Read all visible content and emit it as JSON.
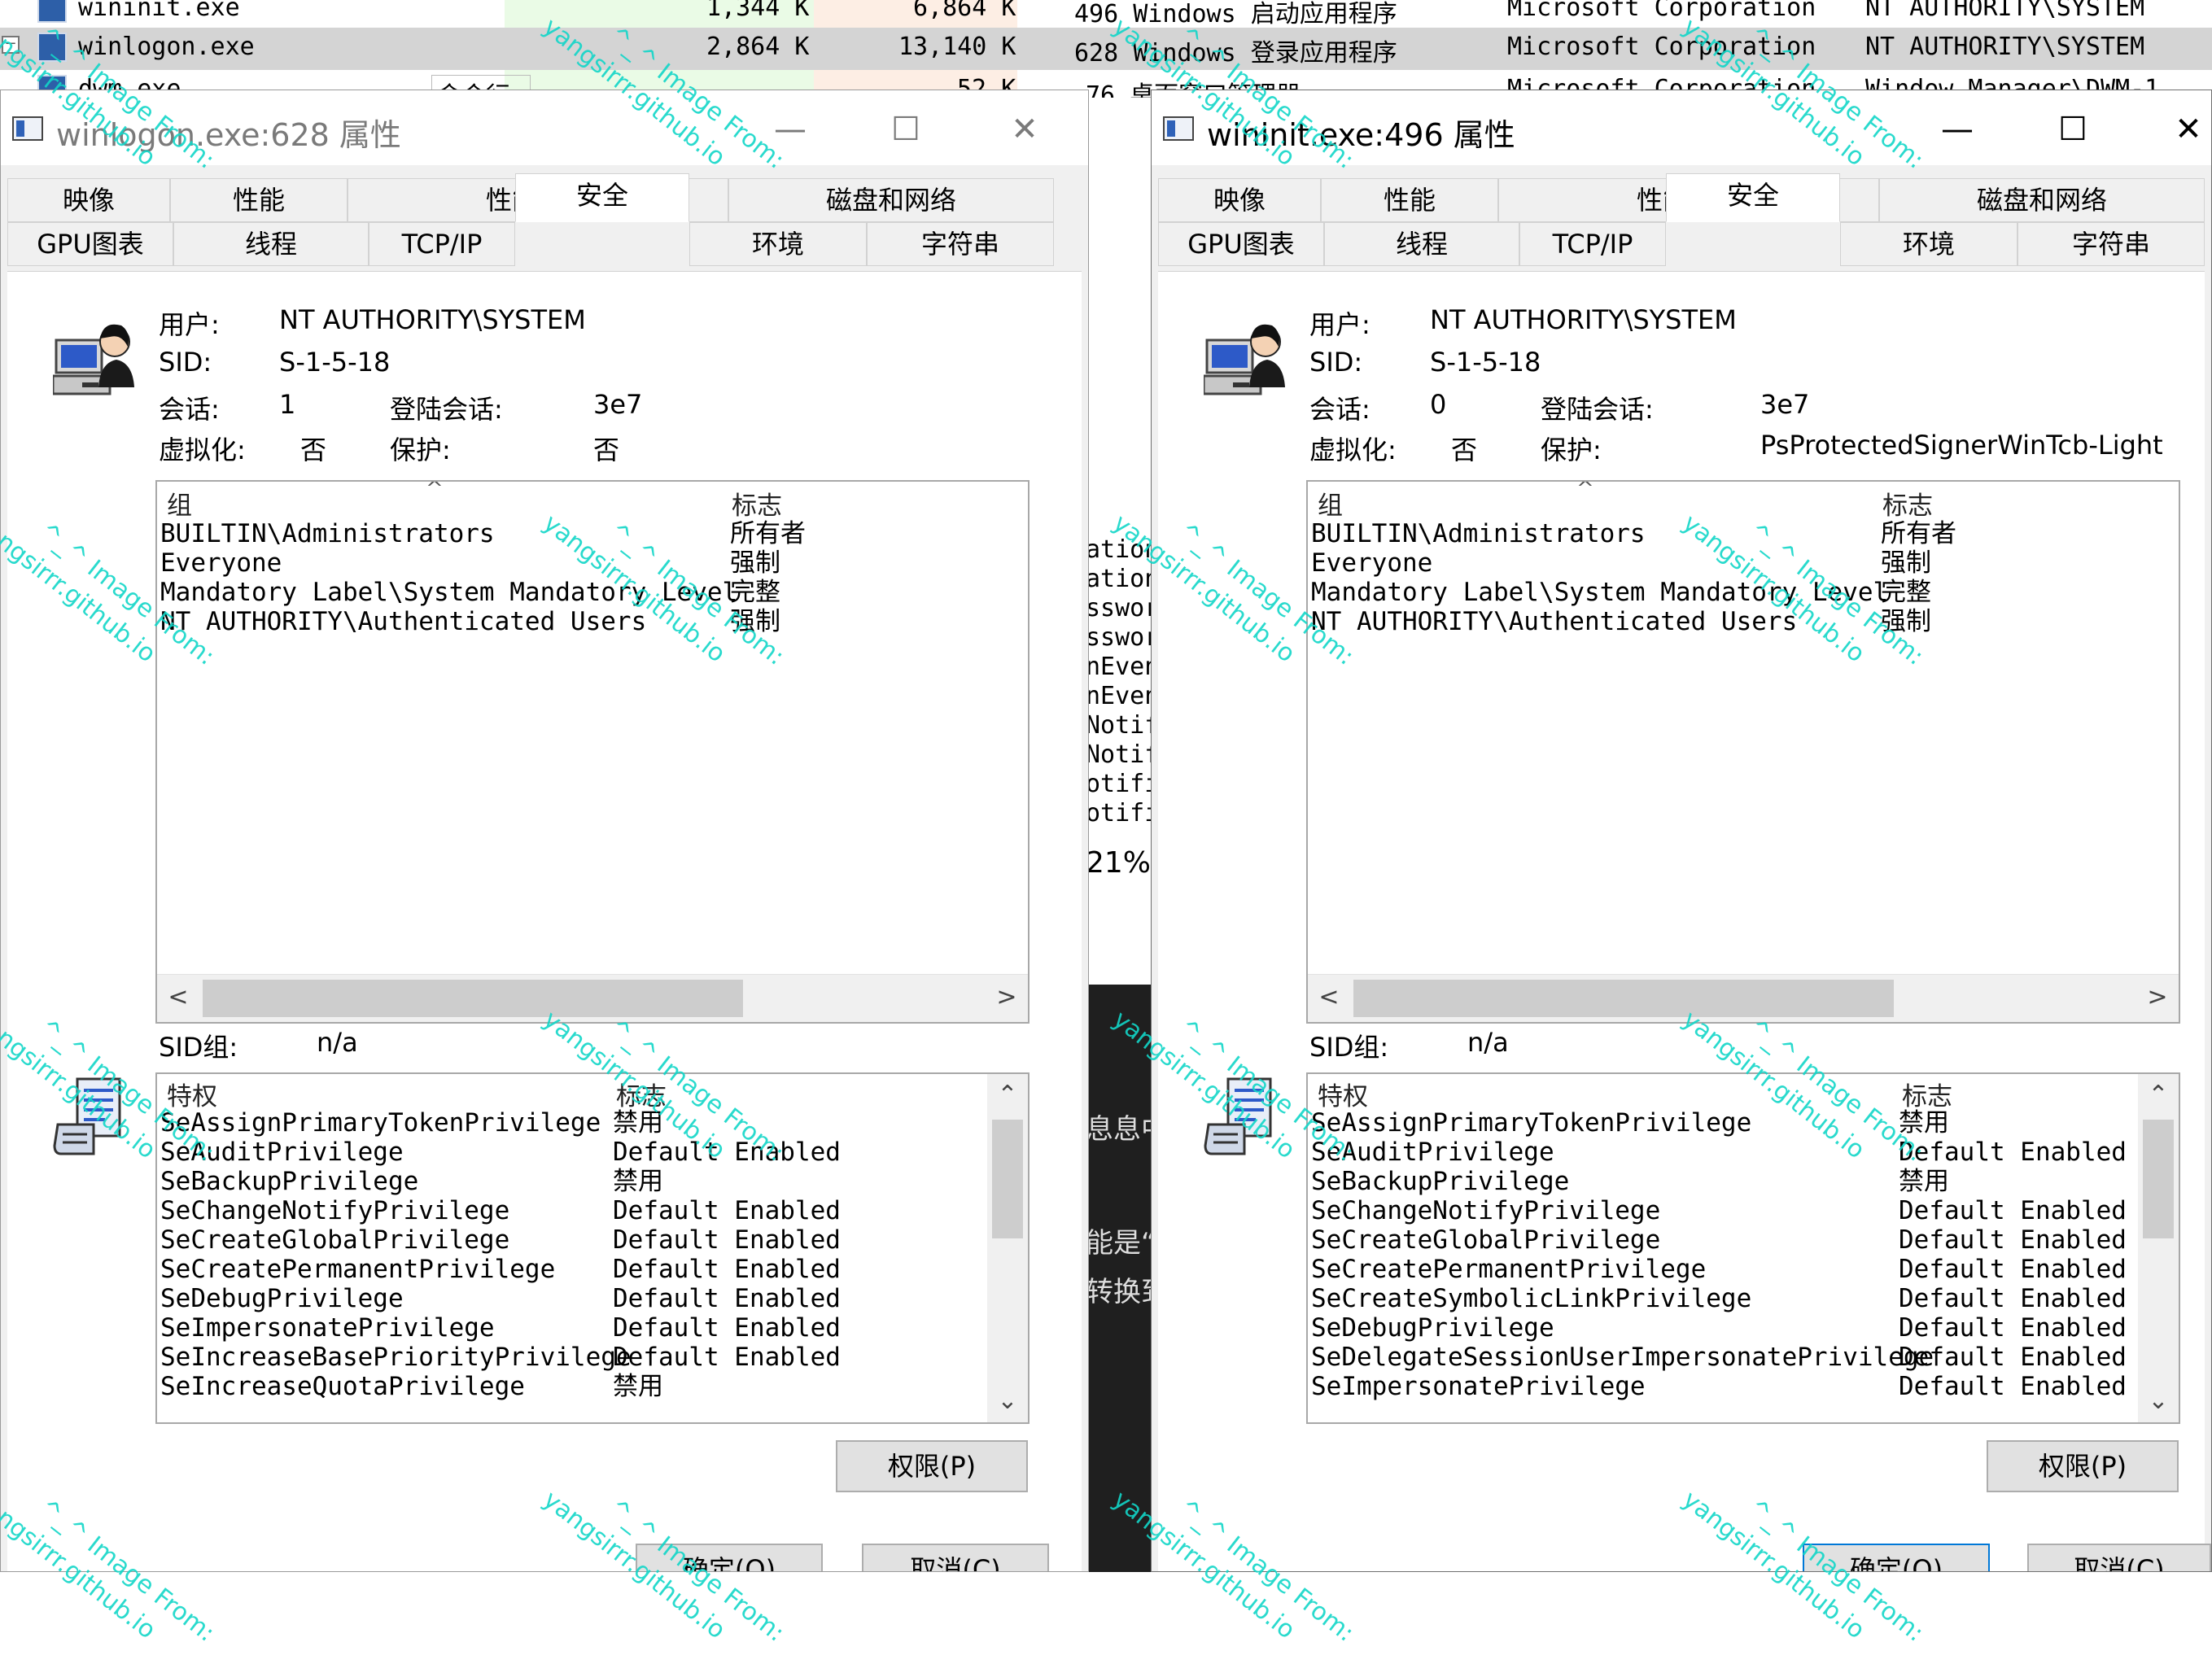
{
  "background_list": {
    "rows": [
      {
        "name": "wininit.exe",
        "private": "1,344 K",
        "working": "6,864 K",
        "pid_desc": "496 Windows 启动应用程序",
        "company": "Microsoft Corporation",
        "user": "NT AUTHORITY\\SYSTEM",
        "selected": false
      },
      {
        "name": "winlogon.exe",
        "private": "2,864 K",
        "working": "13,140 K",
        "pid_desc": "628 Windows 登录应用程序",
        "company": "Microsoft Corporation",
        "user": "NT AUTHORITY\\SYSTEM",
        "selected": true
      },
      {
        "name": "dwm.exe",
        "cmd": "命令行:",
        "working": "52 K",
        "pid_desc": "76 桌面窗口管理器",
        "company": "Microsoft Corporation",
        "user": "Window Manager\\DWM-1",
        "selected": false
      }
    ],
    "tree_toggle": "−"
  },
  "middle_strip": {
    "lines": [
      "ation",
      "ation",
      "sswor",
      "sswor",
      "nEven",
      "nEven",
      "Notif",
      "Notif",
      "otifi",
      "otifi"
    ],
    "percent": "21%",
    "text_a": "息息中",
    "text_b": "能是“",
    "text_c": "转换到"
  },
  "windows": [
    {
      "id": "winlogon",
      "title": "winlogon.exe:628 属性",
      "tabs_row1": [
        "映像",
        "性能",
        "性能图表",
        "磁盘和网络"
      ],
      "tabs_row2": [
        "GPU图表",
        "线程",
        "TCP/IP",
        "安全",
        "环境",
        "字符串"
      ],
      "active_tab": "安全",
      "user_label": "用户:",
      "user_value": "NT AUTHORITY\\SYSTEM",
      "sid_label": "SID:",
      "sid_value": "S-1-5-18",
      "session_label": "会话:",
      "session_value": "1",
      "logon_label": "登陆会话:",
      "logon_value": "3e7",
      "virt_label": "虚拟化:",
      "virt_value": "否",
      "protect_label": "保护:",
      "protect_value": "否",
      "groups_header": {
        "group": "组",
        "flags": "标志"
      },
      "groups": [
        {
          "group": "BUILTIN\\Administrators",
          "flags": "所有者"
        },
        {
          "group": "Everyone",
          "flags": "强制"
        },
        {
          "group": "Mandatory Label\\System Mandatory Level",
          "flags": "完整"
        },
        {
          "group": "NT AUTHORITY\\Authenticated Users",
          "flags": "强制"
        }
      ],
      "sidgroup_label": "SID组:",
      "sidgroup_value": "n/a",
      "priv_header": {
        "priv": "特权",
        "flags": "标志"
      },
      "privileges": [
        {
          "priv": "SeAssignPrimaryTokenPrivilege",
          "flags": "禁用"
        },
        {
          "priv": "SeAuditPrivilege",
          "flags": "Default Enabled"
        },
        {
          "priv": "SeBackupPrivilege",
          "flags": "禁用"
        },
        {
          "priv": "SeChangeNotifyPrivilege",
          "flags": "Default Enabled"
        },
        {
          "priv": "SeCreateGlobalPrivilege",
          "flags": "Default Enabled"
        },
        {
          "priv": "SeCreatePermanentPrivilege",
          "flags": "Default Enabled"
        },
        {
          "priv": "SeDebugPrivilege",
          "flags": "Default Enabled"
        },
        {
          "priv": "SeImpersonatePrivilege",
          "flags": "Default Enabled"
        },
        {
          "priv": "SeIncreaseBasePriorityPrivilege",
          "flags": "Default Enabled"
        },
        {
          "priv": "SeIncreaseQuotaPrivilege",
          "flags": "禁用"
        }
      ],
      "permissions_button": "权限(P)",
      "ok_button": "确定(O)",
      "cancel_button": "取消(C)",
      "win_min": "—",
      "win_max": "☐",
      "win_close": "✕"
    },
    {
      "id": "wininit",
      "title": "wininit.exe:496 属性",
      "tabs_row1": [
        "映像",
        "性能",
        "性能图表",
        "磁盘和网络"
      ],
      "tabs_row2": [
        "GPU图表",
        "线程",
        "TCP/IP",
        "安全",
        "环境",
        "字符串"
      ],
      "active_tab": "安全",
      "user_label": "用户:",
      "user_value": "NT AUTHORITY\\SYSTEM",
      "sid_label": "SID:",
      "sid_value": "S-1-5-18",
      "session_label": "会话:",
      "session_value": "0",
      "logon_label": "登陆会话:",
      "logon_value": "3e7",
      "virt_label": "虚拟化:",
      "virt_value": "否",
      "protect_label": "保护:",
      "protect_value": "PsProtectedSignerWinTcb-Light",
      "groups_header": {
        "group": "组",
        "flags": "标志"
      },
      "groups": [
        {
          "group": "BUILTIN\\Administrators",
          "flags": "所有者"
        },
        {
          "group": "Everyone",
          "flags": "强制"
        },
        {
          "group": "Mandatory Label\\System Mandatory Level",
          "flags": "完整"
        },
        {
          "group": "NT AUTHORITY\\Authenticated Users",
          "flags": "强制"
        }
      ],
      "sidgroup_label": "SID组:",
      "sidgroup_value": "n/a",
      "priv_header": {
        "priv": "特权",
        "flags": "标志"
      },
      "privileges": [
        {
          "priv": "SeAssignPrimaryTokenPrivilege",
          "flags": "禁用"
        },
        {
          "priv": "SeAuditPrivilege",
          "flags": "Default Enabled"
        },
        {
          "priv": "SeBackupPrivilege",
          "flags": "禁用"
        },
        {
          "priv": "SeChangeNotifyPrivilege",
          "flags": "Default Enabled"
        },
        {
          "priv": "SeCreateGlobalPrivilege",
          "flags": "Default Enabled"
        },
        {
          "priv": "SeCreatePermanentPrivilege",
          "flags": "Default Enabled"
        },
        {
          "priv": "SeCreateSymbolicLinkPrivilege",
          "flags": "Default Enabled"
        },
        {
          "priv": "SeDebugPrivilege",
          "flags": "Default Enabled"
        },
        {
          "priv": "SeDelegateSessionUserImpersonatePrivilege",
          "flags": "Default Enabled"
        },
        {
          "priv": "SeImpersonatePrivilege",
          "flags": "Default Enabled"
        }
      ],
      "permissions_button": "权限(P)",
      "ok_button": "确定(O)",
      "cancel_button": "取消(C)",
      "win_min": "—",
      "win_max": "☐",
      "win_close": "✕"
    }
  ],
  "watermark": {
    "line1": "^_^ Image From:",
    "line2": "yangsirrr.github.io"
  },
  "colors": {
    "selection": "#d4d4d4",
    "watermark": "#12d6c8",
    "default_button_border": "#0078d7"
  }
}
